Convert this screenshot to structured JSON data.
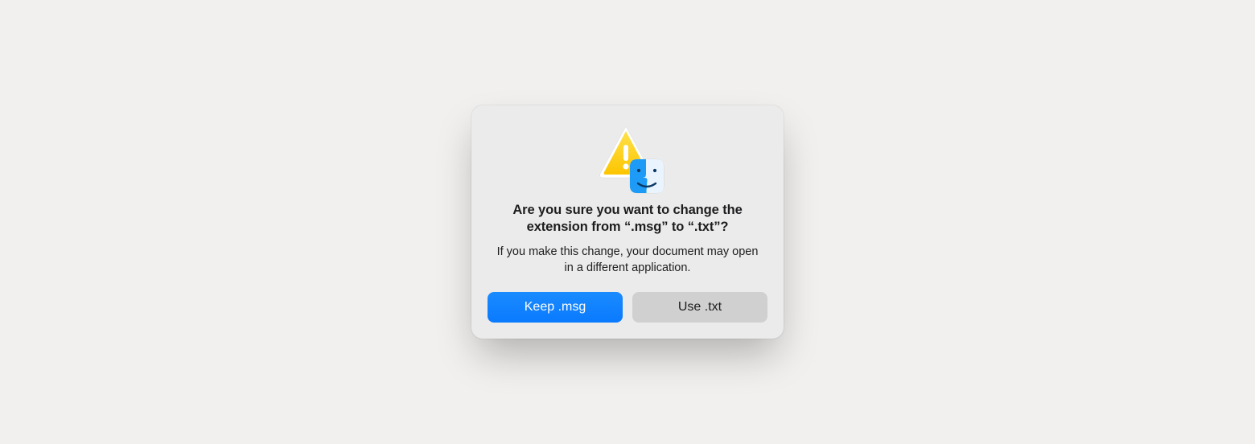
{
  "dialog": {
    "title": "Are you sure you want to change the extension from “.msg” to “.txt”?",
    "message": "If you make this change, your document may open in a different application.",
    "primary_button_label": "Keep .msg",
    "secondary_button_label": "Use .txt",
    "icon_warning": "warning-triangle",
    "icon_app": "finder-icon",
    "colors": {
      "primary": "#0a7aff",
      "secondary": "#d0d0d0",
      "background": "#ebebeb"
    }
  }
}
